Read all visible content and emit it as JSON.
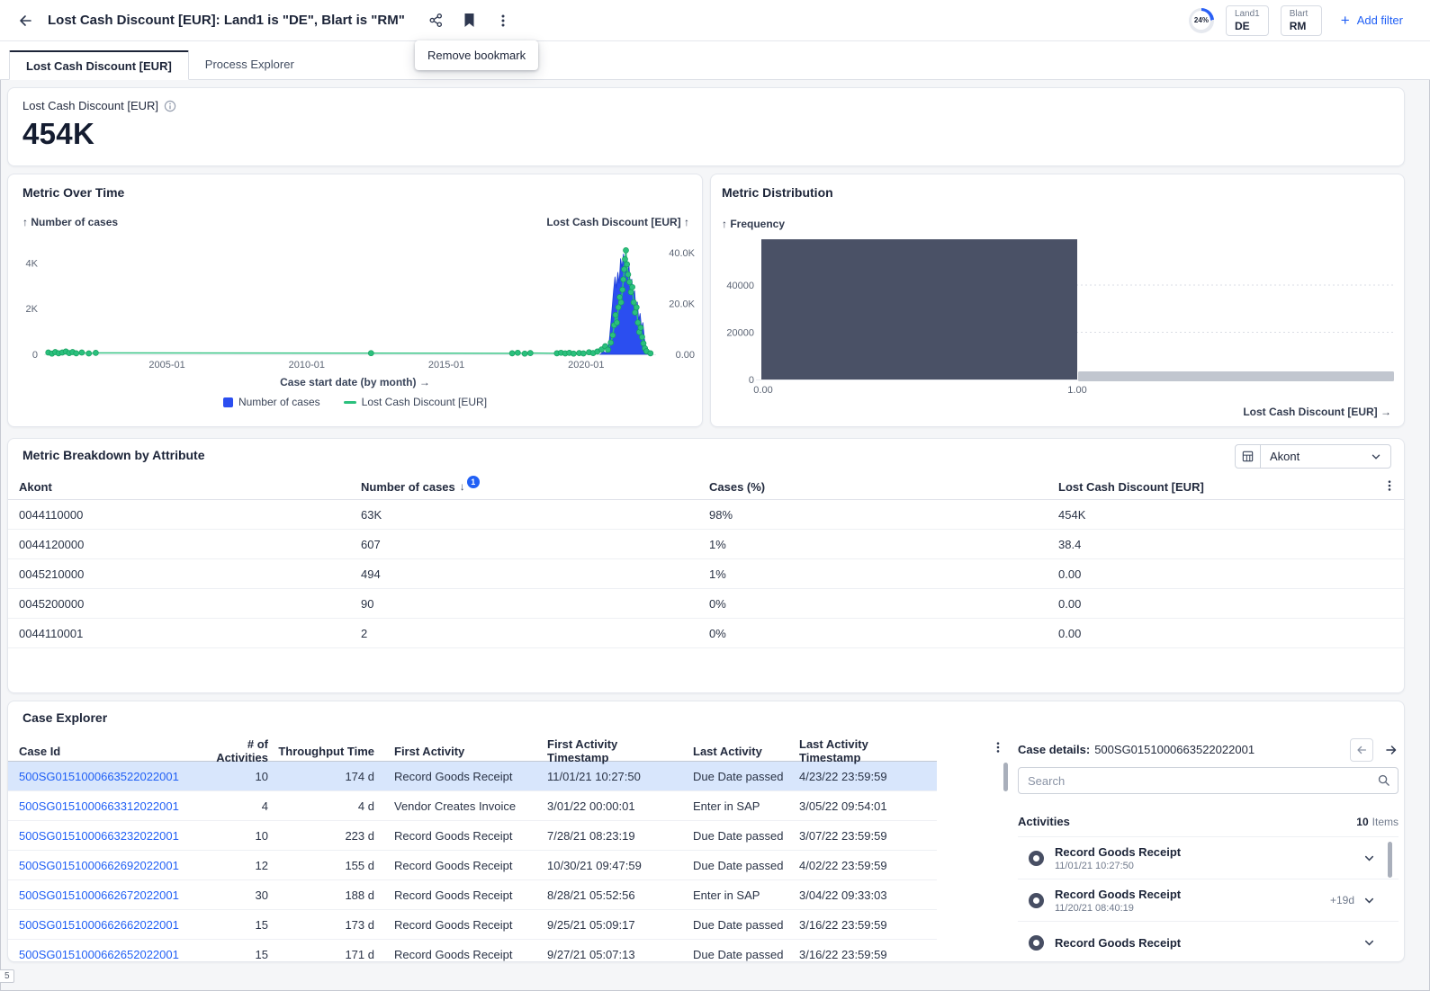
{
  "header": {
    "title": "Lost Cash Discount [EUR]: Land1 is \"DE\", Blart is \"RM\"",
    "progress": "24%",
    "filters": [
      {
        "label": "Land1",
        "value": "DE"
      },
      {
        "label": "Blart",
        "value": "RM"
      }
    ],
    "add_filter_label": "Add filter",
    "tooltip": "Remove bookmark"
  },
  "tabs": {
    "items": [
      {
        "label": "Lost Cash Discount [EUR]",
        "active": true
      },
      {
        "label": "Process Explorer",
        "active": false
      }
    ]
  },
  "kpi": {
    "title": "Lost Cash Discount [EUR]",
    "value": "454K"
  },
  "chart_data": [
    {
      "id": "metric_over_time",
      "type": "line",
      "title": "Metric Over Time",
      "xlabel": "Case start date (by month) →",
      "x_range": [
        2000.6,
        2022.5
      ],
      "x_ticks": [
        [
          2005,
          "2005-01"
        ],
        [
          2010,
          "2010-01"
        ],
        [
          2015,
          "2015-01"
        ],
        [
          2020,
          "2020-01"
        ]
      ],
      "left_axis": {
        "label": "↑ Number of cases",
        "max": 5200,
        "ticks": [
          [
            0,
            "0"
          ],
          [
            2000,
            "2K"
          ],
          [
            4000,
            "4K"
          ]
        ]
      },
      "right_axis": {
        "label": "Lost Cash Discount [EUR] ↑",
        "max": 46800,
        "ticks": [
          [
            0,
            "0.00"
          ],
          [
            20000,
            "20.0K"
          ],
          [
            40000,
            "40.0K"
          ]
        ]
      },
      "legend": [
        {
          "label": "Number of cases",
          "color": "#2B4EF0",
          "shape": "square"
        },
        {
          "label": "Lost Cash Discount [EUR]",
          "color": "#2BC07D",
          "shape": "line"
        }
      ],
      "series": [
        {
          "name": "Number of cases",
          "axis": "left",
          "style": "area",
          "color": "#2B4EF0",
          "points": [
            [
              2020.5,
              0
            ],
            [
              2020.62,
              120
            ],
            [
              2020.72,
              60
            ],
            [
              2020.82,
              500
            ],
            [
              2020.9,
              1600
            ],
            [
              2020.98,
              2800
            ],
            [
              2021.03,
              3400
            ],
            [
              2021.08,
              2900
            ],
            [
              2021.13,
              3600
            ],
            [
              2021.18,
              3100
            ],
            [
              2021.23,
              4200
            ],
            [
              2021.28,
              3800
            ],
            [
              2021.33,
              4400
            ],
            [
              2021.38,
              4000
            ],
            [
              2021.43,
              4300
            ],
            [
              2021.48,
              3500
            ],
            [
              2021.53,
              3900
            ],
            [
              2021.58,
              3000
            ],
            [
              2021.63,
              3300
            ],
            [
              2021.68,
              2500
            ],
            [
              2021.73,
              2800
            ],
            [
              2021.78,
              2000
            ],
            [
              2021.83,
              2300
            ],
            [
              2021.88,
              1500
            ],
            [
              2021.93,
              1800
            ],
            [
              2021.98,
              1100
            ],
            [
              2022.03,
              1400
            ],
            [
              2022.08,
              700
            ],
            [
              2022.13,
              350
            ],
            [
              2022.2,
              120
            ],
            [
              2022.3,
              0
            ]
          ]
        },
        {
          "name": "Lost Cash Discount [EUR]",
          "axis": "right",
          "style": "line-dots",
          "color": "#2BC07D",
          "points": [
            [
              2000.75,
              700
            ],
            [
              2000.88,
              300
            ],
            [
              2001.0,
              900
            ],
            [
              2001.12,
              400
            ],
            [
              2001.25,
              700
            ],
            [
              2001.38,
              1100
            ],
            [
              2001.5,
              500
            ],
            [
              2001.62,
              900
            ],
            [
              2001.75,
              400
            ],
            [
              2001.95,
              700
            ],
            [
              2002.2,
              350
            ],
            [
              2002.45,
              550
            ],
            [
              2012.3,
              450
            ],
            [
              2017.35,
              400
            ],
            [
              2017.55,
              600
            ],
            [
              2017.8,
              300
            ],
            [
              2018.0,
              500
            ],
            [
              2018.95,
              400
            ],
            [
              2019.1,
              600
            ],
            [
              2019.25,
              350
            ],
            [
              2019.4,
              550
            ],
            [
              2019.55,
              300
            ],
            [
              2019.75,
              500
            ],
            [
              2019.9,
              350
            ],
            [
              2020.1,
              800
            ],
            [
              2020.25,
              500
            ],
            [
              2020.4,
              1100
            ],
            [
              2020.55,
              1900
            ],
            [
              2020.68,
              3200
            ],
            [
              2020.78,
              1800
            ],
            [
              2020.88,
              4600
            ],
            [
              2020.95,
              7500
            ],
            [
              2021.0,
              11500
            ],
            [
              2021.05,
              15500
            ],
            [
              2021.1,
              12500
            ],
            [
              2021.15,
              18500
            ],
            [
              2021.2,
              22500
            ],
            [
              2021.25,
              20500
            ],
            [
              2021.3,
              25500
            ],
            [
              2021.33,
              29500
            ],
            [
              2021.36,
              33500
            ],
            [
              2021.39,
              37500
            ],
            [
              2021.42,
              41000
            ],
            [
              2021.46,
              35500
            ],
            [
              2021.5,
              31500
            ],
            [
              2021.55,
              28500
            ],
            [
              2021.6,
              24500
            ],
            [
              2021.65,
              26500
            ],
            [
              2021.7,
              20500
            ],
            [
              2021.75,
              16500
            ],
            [
              2021.8,
              18500
            ],
            [
              2021.85,
              12500
            ],
            [
              2021.9,
              8800
            ],
            [
              2021.95,
              10500
            ],
            [
              2022.0,
              6800
            ],
            [
              2022.05,
              4300
            ],
            [
              2022.1,
              2400
            ],
            [
              2022.16,
              1200
            ],
            [
              2022.3,
              400
            ]
          ]
        }
      ]
    },
    {
      "id": "metric_distribution",
      "type": "bar",
      "title": "Metric Distribution",
      "ylabel": "↑ Frequency",
      "xlabel": "Lost Cash Discount [EUR] →",
      "ymax": 63000,
      "y_ticks": [
        [
          0,
          "0"
        ],
        [
          20000,
          "20000"
        ],
        [
          40000,
          "40000"
        ]
      ],
      "bins": [
        {
          "label_start": "0.00",
          "label_end": "1.00",
          "value": 59400
        }
      ],
      "bar_color": "#4A5166"
    }
  ],
  "breakdown": {
    "title": "Metric Breakdown by Attribute",
    "selector_value": "Akont",
    "columns": [
      "Akont",
      "Number of cases",
      "Cases (%)",
      "Lost Cash Discount [EUR]"
    ],
    "sort_column": "Number of cases",
    "sort_badge": "1",
    "rows": [
      [
        "0044110000",
        "63K",
        "98%",
        "454K"
      ],
      [
        "0044120000",
        "607",
        "1%",
        "38.4"
      ],
      [
        "0045210000",
        "494",
        "1%",
        "0.00"
      ],
      [
        "0045200000",
        "90",
        "0%",
        "0.00"
      ],
      [
        "0044110001",
        "2",
        "0%",
        "0.00"
      ]
    ]
  },
  "case_explorer": {
    "title": "Case Explorer",
    "columns": [
      "Case Id",
      "# of Activities",
      "Throughput Time",
      "First Activity",
      "First Activity Timestamp",
      "Last Activity",
      "Last Activity Timestamp"
    ],
    "rows": [
      {
        "case_id": "500SG0151000663522022001",
        "activities": "10",
        "throughput": "174 d",
        "first_activity": "Record Goods Receipt",
        "first_ts": "11/01/21 10:27:50",
        "last_activity": "Due Date passed",
        "last_ts": "4/23/22 23:59:59",
        "selected": true
      },
      {
        "case_id": "500SG0151000663312022001",
        "activities": "4",
        "throughput": "4 d",
        "first_activity": "Vendor Creates Invoice",
        "first_ts": "3/01/22 00:00:01",
        "last_activity": "Enter in SAP",
        "last_ts": "3/05/22 09:54:01",
        "selected": false
      },
      {
        "case_id": "500SG0151000663232022001",
        "activities": "10",
        "throughput": "223 d",
        "first_activity": "Record Goods Receipt",
        "first_ts": "7/28/21 08:23:19",
        "last_activity": "Due Date passed",
        "last_ts": "3/07/22 23:59:59",
        "selected": false
      },
      {
        "case_id": "500SG0151000662692022001",
        "activities": "12",
        "throughput": "155 d",
        "first_activity": "Record Goods Receipt",
        "first_ts": "10/30/21 09:47:59",
        "last_activity": "Due Date passed",
        "last_ts": "4/02/22 23:59:59",
        "selected": false
      },
      {
        "case_id": "500SG0151000662672022001",
        "activities": "30",
        "throughput": "188 d",
        "first_activity": "Record Goods Receipt",
        "first_ts": "8/28/21 05:52:56",
        "last_activity": "Enter in SAP",
        "last_ts": "3/04/22 09:33:03",
        "selected": false
      },
      {
        "case_id": "500SG0151000662662022001",
        "activities": "15",
        "throughput": "173 d",
        "first_activity": "Record Goods Receipt",
        "first_ts": "9/25/21 05:09:17",
        "last_activity": "Due Date passed",
        "last_ts": "3/16/22 23:59:59",
        "selected": false
      },
      {
        "case_id": "500SG0151000662652022001",
        "activities": "15",
        "throughput": "171 d",
        "first_activity": "Record Goods Receipt",
        "first_ts": "9/27/21 05:07:13",
        "last_activity": "Due Date passed",
        "last_ts": "3/16/22 23:59:59",
        "selected": false
      }
    ]
  },
  "case_details": {
    "title_label": "Case details:",
    "case_id": "500SG0151000663522022001",
    "search_placeholder": "Search",
    "activities_label": "Activities",
    "items_count": "10",
    "items_label": "Items",
    "activities": [
      {
        "name": "Record Goods Receipt",
        "timestamp": "11/01/21 10:27:50",
        "delta": ""
      },
      {
        "name": "Record Goods Receipt",
        "timestamp": "11/20/21 08:40:19",
        "delta": "+19d"
      },
      {
        "name": "Record Goods Receipt",
        "timestamp": "",
        "delta": ""
      }
    ]
  },
  "misc": {
    "corner_fragment": "5"
  }
}
